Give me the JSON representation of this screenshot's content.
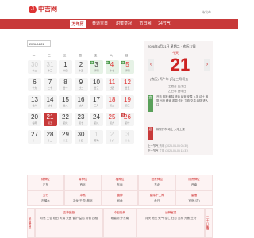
{
  "header": {
    "logo_char": "J",
    "site_name": "中吉网",
    "corner_link": "待发布"
  },
  "nav": {
    "items": [
      {
        "label": "万年历",
        "active": true
      },
      {
        "label": "黄道吉日",
        "active": false
      },
      {
        "label": "甜蜜皇冠",
        "active": false
      },
      {
        "label": "节日网",
        "active": false
      },
      {
        "label": "24节气",
        "active": false
      }
    ]
  },
  "calendar": {
    "date_select": "2026-04-21",
    "weekdays": [
      "一",
      "二",
      "三",
      "四",
      "五",
      "六",
      "日"
    ],
    "rows": [
      [
        {
          "d": "30",
          "l": "十二",
          "faded": true
        },
        {
          "d": "31",
          "l": "十三",
          "faded": true
        },
        {
          "d": "1",
          "l": "十四"
        },
        {
          "d": "2",
          "l": "十五"
        },
        {
          "d": "3",
          "l": "清明",
          "green": true,
          "tag": "休"
        },
        {
          "d": "4",
          "l": "十七",
          "wkend": true,
          "green": true,
          "tag": "休"
        },
        {
          "d": "5",
          "l": "清明",
          "wkend": true,
          "green": true,
          "tag": "休"
        }
      ],
      [
        {
          "d": "6",
          "l": "十九"
        },
        {
          "d": "7",
          "l": "二十"
        },
        {
          "d": "8",
          "l": "廿一"
        },
        {
          "d": "9",
          "l": "廿二"
        },
        {
          "d": "10",
          "l": "廿三"
        },
        {
          "d": "11",
          "l": "廿四",
          "wkend": true
        },
        {
          "d": "12",
          "l": "廿五",
          "wkend": true
        }
      ],
      [
        {
          "d": "13",
          "l": "廿六"
        },
        {
          "d": "14",
          "l": "廿七"
        },
        {
          "d": "15",
          "l": "廿八"
        },
        {
          "d": "16",
          "l": "廿九"
        },
        {
          "d": "17",
          "l": "三月"
        },
        {
          "d": "18",
          "l": "初二",
          "wkend": true
        },
        {
          "d": "19",
          "l": "初三",
          "wkend": true
        }
      ],
      [
        {
          "d": "20",
          "l": "谷雨"
        },
        {
          "d": "21",
          "l": "初五",
          "sel": true
        },
        {
          "d": "22",
          "l": "初六"
        },
        {
          "d": "23",
          "l": "初七"
        },
        {
          "d": "24",
          "l": "初八"
        },
        {
          "d": "25",
          "l": "初九",
          "wkend": true
        },
        {
          "d": "26",
          "l": "初十",
          "wkend": true,
          "tag": "班",
          "ban": true
        }
      ],
      [
        {
          "d": "27",
          "l": "十一"
        },
        {
          "d": "28",
          "l": "十二"
        },
        {
          "d": "29",
          "l": "十三"
        },
        {
          "d": "30",
          "l": "十四"
        },
        {
          "d": "1",
          "l": "劳动",
          "faded": true
        },
        {
          "d": "2",
          "l": "十六",
          "faded": true
        },
        {
          "d": "3",
          "l": "十七",
          "faded": true
        }
      ]
    ]
  },
  "info": {
    "date_line": "2026年4月21日 星期二 · 农历17周",
    "today": "今天",
    "day": "21",
    "lunar": "(农历) 丙午年 [马] 三月初五",
    "ganzhi1": "壬辰月 庚戌日",
    "ganzhi2": "乙巳年 庚申日",
    "yi_label": "宜",
    "yi_text": "开市 祭祀 解除 修造 纳采 安葬 入宅 动土 嫁娶 出行 移徙 求嗣 作灶 立券 交易 纳财 进人口",
    "ji_label": "忌",
    "ji_text": "嫁娶开市 动土 入宅上梁",
    "prev_jq_label": "上一节气",
    "prev_jq": "清明 (2026-04-05 03:39)",
    "next_jq_label": "下一节气",
    "next_jq": "立夏 (2026-05-05 13:37)"
  },
  "grid": {
    "row1": [
      {
        "h": "财神位",
        "v": "正东"
      },
      {
        "h": "喜神位",
        "v": "西北"
      },
      {
        "h": "福神位",
        "v": "东南"
      },
      {
        "h": "阳贵神位",
        "v": "东北"
      },
      {
        "h": "阴贵神位",
        "v": "西南"
      }
    ],
    "row2": [
      {
        "h": "五行",
        "v": "石榴木"
      },
      {
        "h": "冲煞",
        "v": "冲龙(壬辰) 煞北"
      },
      {
        "h": "值神",
        "v": "司命"
      },
      {
        "h": "建除十二神",
        "v": "危日"
      },
      {
        "h": "星宿",
        "v": "室宿 (吉)"
      }
    ],
    "row3": [
      {
        "h": "吉神宜趋",
        "v": "月恩 三合 临日 天喜 天医 普护 益后 月德 四相"
      },
      {
        "h": "今日胎神",
        "v": "碓磨厕 外东南"
      },
      {
        "h": "凶神宜忌",
        "v": "月厌 地火 死气 往亡 归忌 九坎 九焦 土符"
      }
    ],
    "side": "二十八星宿",
    "side_left": "彭祖百忌"
  }
}
